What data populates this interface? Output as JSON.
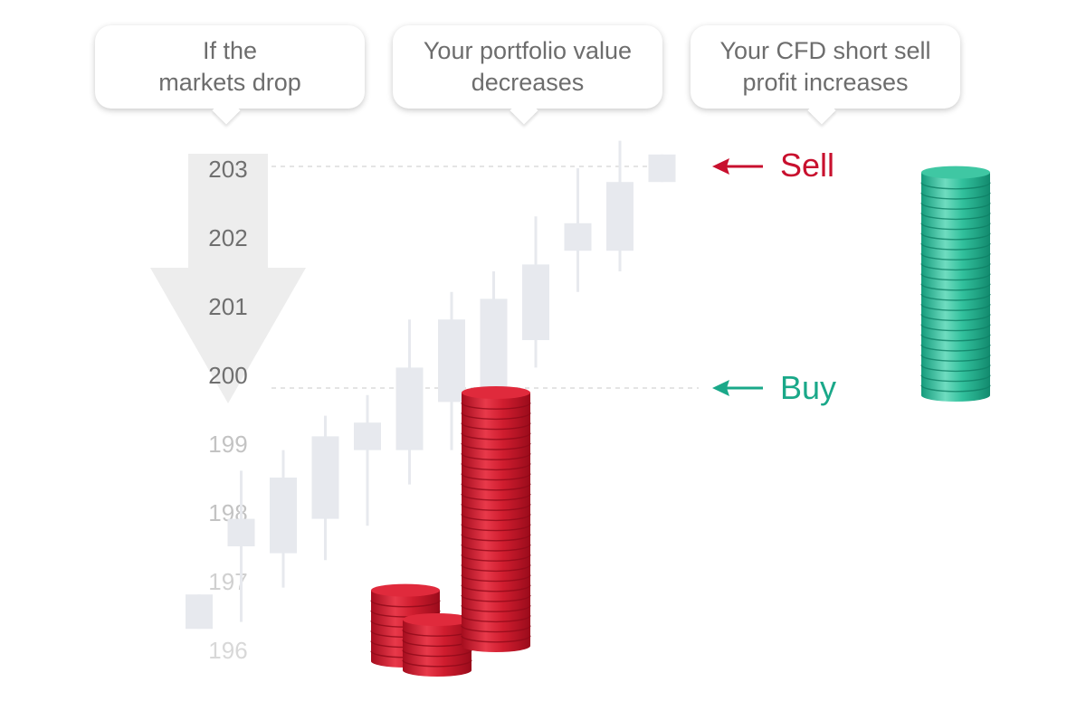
{
  "callouts": [
    {
      "text": "If the\nmarkets drop"
    },
    {
      "text": "Your portfolio value\ndecreases"
    },
    {
      "text": "Your CFD short sell\nprofit increases"
    }
  ],
  "price_axis": {
    "ticks": [
      "203",
      "202",
      "201",
      "200",
      "199",
      "198",
      "197",
      "196"
    ]
  },
  "labels": {
    "sell": "Sell",
    "buy": "Buy"
  },
  "candles": [
    {
      "open": 196.3,
      "close": 196.8,
      "low": 196.3,
      "high": 196.8
    },
    {
      "open": 197.5,
      "close": 197.9,
      "low": 196.4,
      "high": 198.6
    },
    {
      "open": 197.4,
      "close": 198.5,
      "low": 196.9,
      "high": 198.9
    },
    {
      "open": 197.9,
      "close": 199.1,
      "low": 197.3,
      "high": 199.4
    },
    {
      "open": 198.9,
      "close": 199.3,
      "low": 197.8,
      "high": 199.7
    },
    {
      "open": 198.9,
      "close": 200.1,
      "low": 198.4,
      "high": 200.8
    },
    {
      "open": 199.6,
      "close": 200.8,
      "low": 198.9,
      "high": 201.2
    },
    {
      "open": 199.8,
      "close": 201.1,
      "low": 199.3,
      "high": 201.5
    },
    {
      "open": 200.5,
      "close": 201.6,
      "low": 200.1,
      "high": 202.3
    },
    {
      "open": 201.8,
      "close": 202.2,
      "low": 201.2,
      "high": 203.0
    },
    {
      "open": 201.8,
      "close": 202.8,
      "low": 201.5,
      "high": 203.4
    },
    {
      "open": 202.8,
      "close": 203.2,
      "low": 202.8,
      "high": 203.2
    }
  ],
  "colors": {
    "candle": "#e7e9ee",
    "sell": "#c8102e",
    "buy": "#1aa889",
    "arrow": "#ededed",
    "coin_red": "#cc1a2c",
    "coin_green": "#2bb795"
  }
}
